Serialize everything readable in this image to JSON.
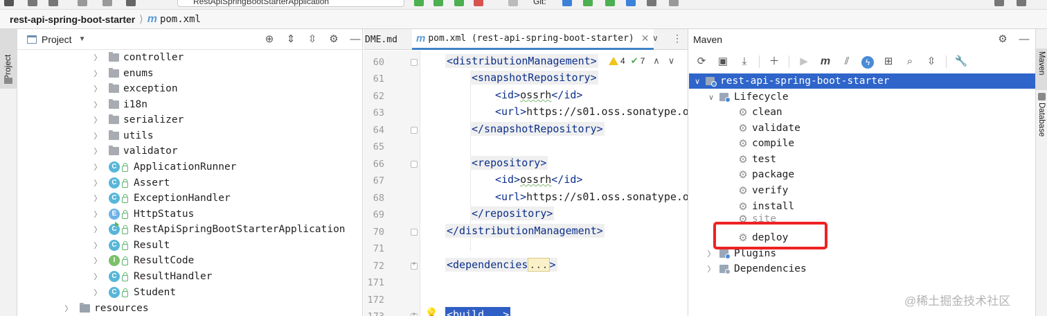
{
  "toolbar": {
    "run_config": "RestApiSpringBootStarterApplication",
    "git_label": "Git:"
  },
  "breadcrumb": {
    "project": "rest-api-spring-boot-starter",
    "file": "pom.xml"
  },
  "left_stripe": {
    "project_tab": "Project"
  },
  "project_panel": {
    "title": "Project",
    "folders": [
      {
        "label": "controller"
      },
      {
        "label": "enums"
      },
      {
        "label": "exception"
      },
      {
        "label": "i18n"
      },
      {
        "label": "serializer"
      },
      {
        "label": "utils"
      },
      {
        "label": "validator"
      }
    ],
    "classes": [
      {
        "label": "ApplicationRunner",
        "kind": "C"
      },
      {
        "label": "Assert",
        "kind": "C"
      },
      {
        "label": "ExceptionHandler",
        "kind": "C"
      },
      {
        "label": "HttpStatus",
        "kind": "E"
      },
      {
        "label": "RestApiSpringBootStarterApplication",
        "kind": "C"
      },
      {
        "label": "Result",
        "kind": "C"
      },
      {
        "label": "ResultCode",
        "kind": "I"
      },
      {
        "label": "ResultHandler",
        "kind": "C"
      },
      {
        "label": "Student",
        "kind": "C"
      }
    ],
    "resources": "resources"
  },
  "editor": {
    "tabs": [
      {
        "label": "DME.md"
      },
      {
        "label": "pom.xml (rest-api-spring-boot-starter)"
      }
    ],
    "inspections": {
      "warnings": "4",
      "ok": "7"
    },
    "line_numbers": [
      "60",
      "61",
      "62",
      "63",
      "64",
      "65",
      "66",
      "67",
      "68",
      "69",
      "70",
      "71",
      "72",
      "171",
      "172",
      "173"
    ],
    "code": {
      "l60": "<distributionManagement>",
      "l61": "<snapshotRepository>",
      "l62_open": "<id>",
      "l62_val": "ossrh",
      "l62_close": "</id>",
      "l63_open": "<url>",
      "l63_val": "https://s01.oss.sonatype.o",
      "l64": "</snapshotRepository>",
      "l66": "<repository>",
      "l67_open": "<id>",
      "l67_val": "ossrh",
      "l67_close": "</id>",
      "l68_open": "<url>",
      "l68_val": "https://s01.oss.sonatype.o",
      "l69": "</repository>",
      "l70": "</distributionManagement>",
      "l72_tag": "<dependencies",
      "l72_fold": "...",
      "l72_end": ">",
      "l173": "<build...>"
    }
  },
  "maven": {
    "title": "Maven",
    "root": "rest-api-spring-boot-starter",
    "lifecycle_label": "Lifecycle",
    "lifecycle": [
      "clean",
      "validate",
      "compile",
      "test",
      "package",
      "verify",
      "install",
      "site",
      "deploy"
    ],
    "plugins_label": "Plugins",
    "dependencies_label": "Dependencies"
  },
  "right_stripe": {
    "maven_tab": "Maven",
    "database_tab": "Database"
  },
  "watermark": "@稀土掘金技术社区",
  "colors": {
    "selection": "#2f65ca",
    "highlight_box": "#ee2222",
    "xml_tag": "#0b2f8a"
  }
}
